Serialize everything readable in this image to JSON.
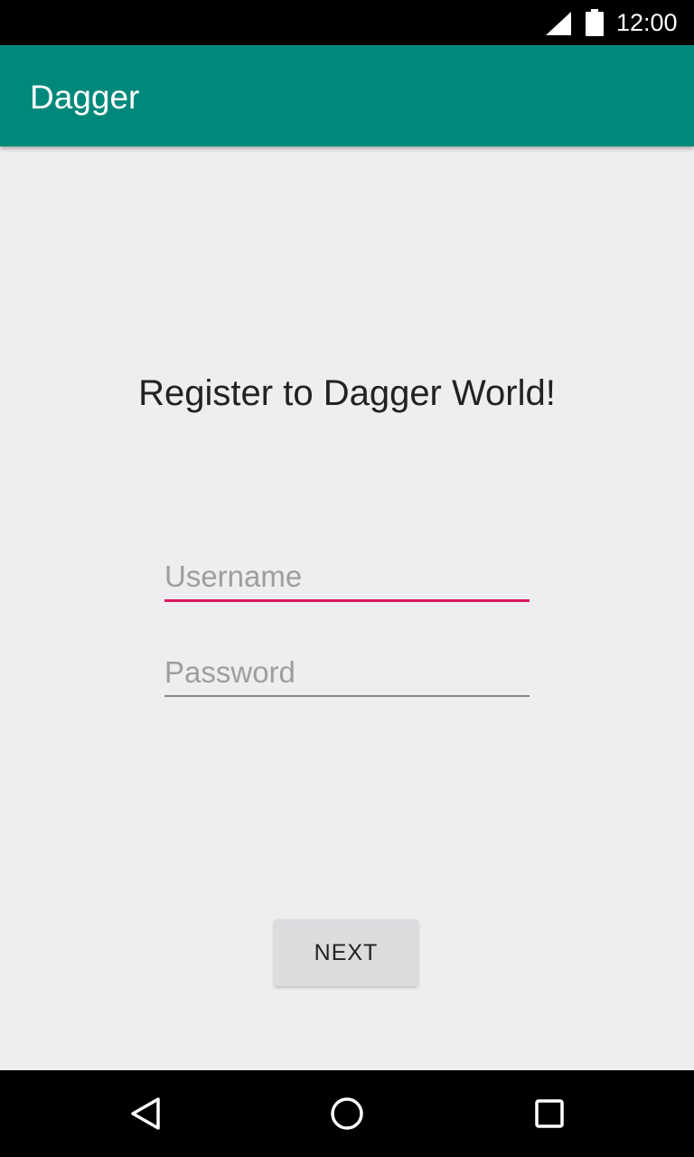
{
  "status_bar": {
    "time": "12:00",
    "icons": [
      "signal-icon",
      "battery-icon"
    ]
  },
  "app_bar": {
    "title": "Dagger",
    "color": "#00897b"
  },
  "registration": {
    "heading": "Register to Dagger World!",
    "username": {
      "value": "",
      "placeholder": "Username"
    },
    "password": {
      "value": "",
      "placeholder": "Password"
    },
    "next_label": "NEXT",
    "accent_color": "#d81b60"
  },
  "nav_bar": {
    "buttons": [
      "back-icon",
      "home-icon",
      "recents-icon"
    ]
  }
}
